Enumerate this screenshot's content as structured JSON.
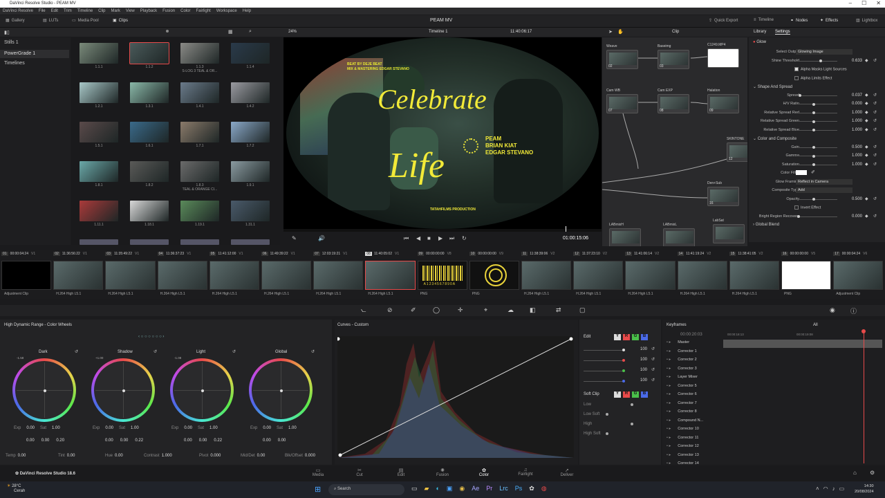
{
  "window": {
    "title": "DaVinci Resolve Studio - PEAM MV"
  },
  "menu": [
    "DaVinci Resolve",
    "File",
    "Edit",
    "Trim",
    "Timeline",
    "Clip",
    "Mark",
    "View",
    "Playback",
    "Fusion",
    "Color",
    "Fairlight",
    "Workspace",
    "Help"
  ],
  "toolbar": {
    "gallery": "Gallery",
    "luts": "LUTs",
    "media_pool": "Media Pool",
    "clips": "Clips",
    "project": "PEAM MV",
    "quick_export": "Quick Export",
    "timeline": "Timeline",
    "nodes": "Nodes",
    "effects": "Effects",
    "lightbox": "Lightbox"
  },
  "viewer": {
    "zoom": "24%",
    "timeline_name": "Timeline 1",
    "timecode": "11:40:06:17",
    "mode": "Clip",
    "playhead_tc": "01:00:15:06",
    "text_celebrate": "Celebrate",
    "text_life": "Life",
    "credits": [
      "PEAM",
      "BRIAN KIAT",
      "EDGAR STEVANO"
    ],
    "beat_line1": "BEAT BY DEJE BEAT",
    "beat_line2": "MIX & MASTERING EDGAR STEVANO",
    "production": "TATAHFILMS PRODUCTION"
  },
  "gallery": {
    "items": [
      "Stills 1",
      "PowerGrade 1",
      "Timelines"
    ]
  },
  "thumbs": [
    {
      "label": "1.1.1",
      "c": "#7a8a7a"
    },
    {
      "label": "1.1.2",
      "c": "#4a5a5a"
    },
    {
      "label": "1.1.3",
      "sub": "S-LOG 3 TEAL & OR...",
      "c": "#8a8a86"
    },
    {
      "label": "1.1.4",
      "c": "#2a3a4a"
    },
    {
      "label": "1.2.1",
      "c": "#a8c8c8"
    },
    {
      "label": "1.3.1",
      "c": "#8ab8a8"
    },
    {
      "label": "1.4.1",
      "c": "#6a7a8a"
    },
    {
      "label": "1.4.2",
      "c": "#9a9aa0"
    },
    {
      "label": "1.5.1",
      "c": "#5a4a4a"
    },
    {
      "label": "1.6.1",
      "c": "#3a6a8a"
    },
    {
      "label": "1.7.1",
      "c": "#8a7a6a"
    },
    {
      "label": "1.7.2",
      "c": "#8aa8c8"
    },
    {
      "label": "1.8.1",
      "c": "#6aa8a8"
    },
    {
      "label": "1.8.2",
      "c": "#5a5a58"
    },
    {
      "label": "1.8.3",
      "sub": "TEAL & ORANGE CI...",
      "c": "#6a6a6a"
    },
    {
      "label": "1.9.1",
      "c": "#8a9aa0"
    },
    {
      "label": "1.11.1",
      "c": "#aa3a3a"
    },
    {
      "label": "1.18.1",
      "c": "#d8d8d8"
    },
    {
      "label": "1.19.1",
      "c": "#5a8a5a"
    },
    {
      "label": "1.31.1",
      "c": "#4a5a6a"
    }
  ],
  "timeline_clips": [
    {
      "n": "01",
      "tc": "00:00:04:24",
      "v": "V1",
      "codec": "Adjustment Clip"
    },
    {
      "n": "02",
      "tc": "11:36:56:22",
      "v": "V1",
      "codec": "H.264 High L5.1"
    },
    {
      "n": "03",
      "tc": "11:35:49:22",
      "v": "V1",
      "codec": "H.264 High L5.1"
    },
    {
      "n": "04",
      "tc": "11:36:37:23",
      "v": "V1",
      "codec": "H.264 High L5.1"
    },
    {
      "n": "05",
      "tc": "11:41:12:00",
      "v": "V1",
      "codec": "H.264 High L5.1"
    },
    {
      "n": "06",
      "tc": "11:49:39:22",
      "v": "V1",
      "codec": "H.264 High L5.1"
    },
    {
      "n": "07",
      "tc": "12:03:19:21",
      "v": "V1",
      "codec": "H.264 High L5.1"
    },
    {
      "n": "08",
      "tc": "11:40:05:02",
      "v": "V1",
      "codec": "H.264 High L5.1"
    },
    {
      "n": "09",
      "tc": "00:00:00:00",
      "v": "V8",
      "codec": "PNG"
    },
    {
      "n": "10",
      "tc": "00:00:00:00",
      "v": "V9",
      "codec": "PNG"
    },
    {
      "n": "11",
      "tc": "11:38:39:06",
      "v": "V2",
      "codec": "H.264 High L5.1"
    },
    {
      "n": "12",
      "tc": "11:37:23:10",
      "v": "V2",
      "codec": "H.264 High L5.1"
    },
    {
      "n": "13",
      "tc": "11:41:06:14",
      "v": "V2",
      "codec": "H.264 High L5.1"
    },
    {
      "n": "14",
      "tc": "11:41:19:24",
      "v": "V2",
      "codec": "H.264 High L5.1"
    },
    {
      "n": "15",
      "tc": "11:38:41:05",
      "v": "V2",
      "codec": "H.264 High L5.1"
    },
    {
      "n": "16",
      "tc": "00:00:00:00",
      "v": "V5",
      "codec": "PNG"
    },
    {
      "n": "17",
      "tc": "00:00:04:24",
      "v": "V6",
      "codec": "Adjustment Clip"
    }
  ],
  "barcode": "A1234567890A",
  "nodes": [
    {
      "title": "Weave",
      "num": "02"
    },
    {
      "title": "Baseimg",
      "num": "03"
    },
    {
      "title": "C1249.MP4",
      "num": ""
    },
    {
      "title": "Cam WB",
      "num": "07"
    },
    {
      "title": "Cam EXP",
      "num": "08"
    },
    {
      "title": "Halation",
      "num": "09"
    },
    {
      "title": "SKINTONE",
      "num": "12"
    },
    {
      "title": "Den+Sub",
      "num": "16"
    },
    {
      "title": "LABmixH",
      "num": ""
    },
    {
      "title": "LABmixL",
      "num": ""
    },
    {
      "title": "LabSat",
      "num": ""
    }
  ],
  "settings": {
    "tab_library": "Library",
    "tab_settings": "Settings",
    "fx_name": "Glow",
    "rows": [
      {
        "label": "Select Output",
        "value": "Glowing Image"
      },
      {
        "label": "Shine Threshold",
        "value": "0.633"
      },
      {
        "label": "Alpha Masks Light Sources",
        "value": ""
      },
      {
        "label": "Alpha Limits Effect",
        "value": ""
      },
      {
        "label": "Shape And Spread",
        "value": ""
      },
      {
        "label": "Spread",
        "value": "0.037"
      },
      {
        "label": "H/V Ratio",
        "value": "0.000"
      },
      {
        "label": "Relative Spread Red",
        "value": "1.000"
      },
      {
        "label": "Relative Spread Green",
        "value": "1.000"
      },
      {
        "label": "Relative Spread Blue",
        "value": "1.000"
      },
      {
        "label": "Color and Composite",
        "value": ""
      },
      {
        "label": "Gain",
        "value": "0.500"
      },
      {
        "label": "Gamma",
        "value": "1.000"
      },
      {
        "label": "Saturation",
        "value": "1.000"
      },
      {
        "label": "Color Filter",
        "value": ""
      },
      {
        "label": "Glow Framing",
        "value": "Reflect in Camera"
      },
      {
        "label": "Composite Type",
        "value": "Add"
      },
      {
        "label": "Opacity",
        "value": "0.500"
      },
      {
        "label": "Invert Effect",
        "value": ""
      },
      {
        "label": "Bright Region Recovery",
        "value": "0.000"
      },
      {
        "label": "Global Blend",
        "value": ""
      }
    ]
  },
  "color_wheels": {
    "title": "High Dynamic Range - Color Wheels",
    "wheels": [
      {
        "name": "Dark",
        "ev": "-1.58",
        "exp": "0.00",
        "sat": "1.00",
        "x": "0.00",
        "y": "0.00",
        "z": "0.20"
      },
      {
        "name": "Shadow",
        "ev": "+1.00",
        "exp": "0.00",
        "sat": "1.00",
        "x": "0.00",
        "y": "0.00",
        "z": "0.22"
      },
      {
        "name": "Light",
        "ev": "-1.08",
        "exp": "0.00",
        "sat": "1.00",
        "x": "0.00",
        "y": "0.00",
        "z": "0.22"
      },
      {
        "name": "Global",
        "ev": "",
        "exp": "0.00",
        "sat": "1.00",
        "x": "0.00",
        "y": "0.00",
        "z": ""
      }
    ],
    "bottom": [
      {
        "k": "Temp",
        "v": "0.00"
      },
      {
        "k": "Tint",
        "v": "0.00"
      },
      {
        "k": "Hue",
        "v": "0.00"
      },
      {
        "k": "Contrast",
        "v": "1.000"
      },
      {
        "k": "Pivot",
        "v": "0.000"
      },
      {
        "k": "Mid/Det",
        "v": "0.00"
      },
      {
        "k": "Blk/Offset",
        "v": "0.000"
      }
    ]
  },
  "curves": {
    "title": "Curves - Custom",
    "edit": "Edit",
    "soft_clip": "Soft Clip",
    "values": [
      "100",
      "100",
      "100",
      "100"
    ],
    "softclip_rows": [
      "Low",
      "Low Soft",
      "High",
      "High Soft"
    ],
    "chan": [
      "Y",
      "R",
      "G",
      "B"
    ]
  },
  "keyframes": {
    "title": "Keyframes",
    "filter": "All",
    "tc": "00:00:20:03",
    "tc2": "00:00:18:13",
    "tc3": "00:00:19:08",
    "rows": [
      "Master",
      "Corrector 1",
      "Corrector 2",
      "Corrector 3",
      "Layer Mixer",
      "Corrector 5",
      "Corrector 6",
      "Corrector 7",
      "Corrector 8",
      "Compound N...",
      "Corrector 10",
      "Corrector 11",
      "Corrector 12",
      "Corrector 13",
      "Corrector 14"
    ]
  },
  "pages": [
    "Media",
    "Cut",
    "Edit",
    "Fusion",
    "Color",
    "Fairlight",
    "Deliver"
  ],
  "active_page": "Color",
  "app_badge": "DaVinci Resolve Studio 18.6",
  "taskbar": {
    "weather_temp": "28°C",
    "weather_desc": "Cerah",
    "search": "Search",
    "time": "14:30",
    "date": "20/08/2024"
  }
}
